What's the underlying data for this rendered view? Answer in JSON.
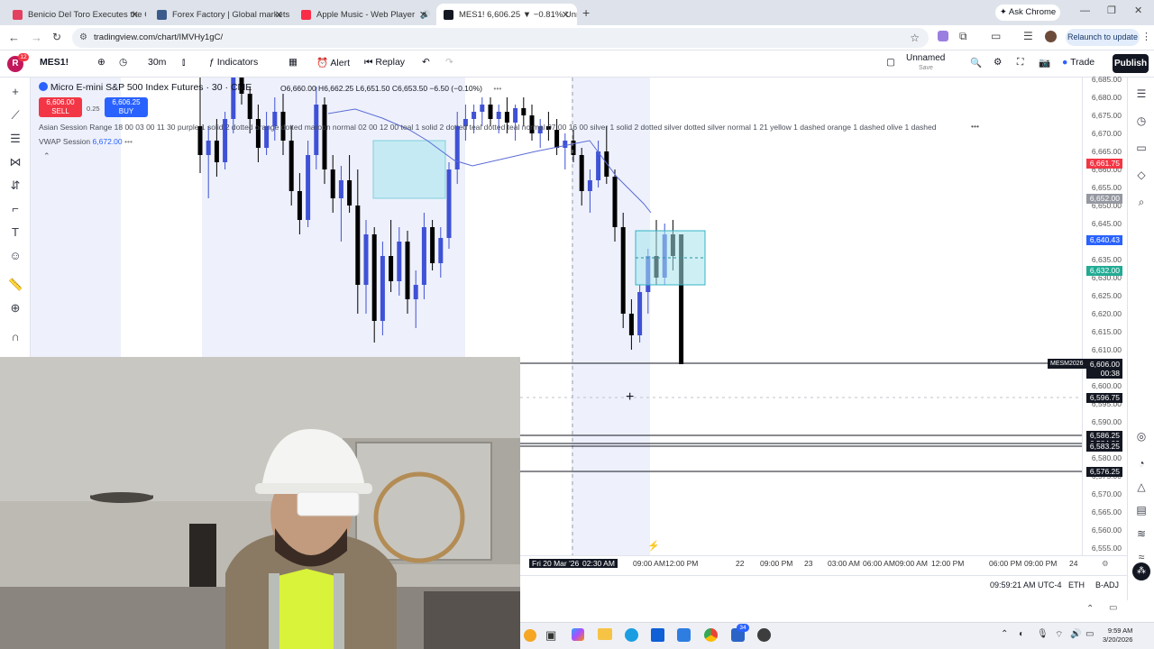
{
  "browser": {
    "tabs": [
      {
        "title": "Benicio Del Toro Executes the C",
        "color": "#e4405f"
      },
      {
        "title": "Forex Factory | Global markets",
        "color": "#3a5b8c"
      },
      {
        "title": "Apple Music - Web Player",
        "color": "#fa2d48"
      },
      {
        "title": "MES1! 6,606.25 ▼ −0.81% Unn",
        "color": "#131722"
      }
    ],
    "ask": "Ask Chrome",
    "url": "tradingview.com/chart/IMVHy1gC/",
    "relaunch": "Relaunch to update"
  },
  "toolbar": {
    "profile": "R",
    "profile_badge": "12",
    "symbol": "MES1!",
    "interval": "30m",
    "indicators": "Indicators",
    "alert": "Alert",
    "replay": "Replay",
    "layout_name": "Unnamed",
    "layout_sub": "Save",
    "trade": "Trade",
    "publish": "Publish"
  },
  "legend": {
    "title": "Micro E-mini S&P 500 Index Futures · 30 · CME",
    "ohlc": "O6,660.00 H6,662.25 L6,651.50 C6,653.50 −6.50 (−0.10%)",
    "sell_price": "6,606.00",
    "sell": "SELL",
    "spread": "0.25",
    "buy_price": "6,606.25",
    "buy": "BUY",
    "indicator1": "Asian Session Range 18 00 03 00 11 30 purple 1 solid 2 dotted orange dotted maroon normal 02 00 12 00 teal 1 solid 2 dotted teal dotted teal normal 07 00 16 00 silver 1 solid 2 dotted silver dotted silver normal 1 21 yellow 1 dashed orange 1 dashed olive 1 dashed",
    "indicator2_name": "VWAP Session",
    "indicator2_value": "6,672.00"
  },
  "chart_data": {
    "type": "candlestick",
    "symbol": "MES1!",
    "interval": "30m",
    "y_ticks": [
      6685,
      6680,
      6675,
      6670,
      6665,
      6660,
      6655,
      6650,
      6645,
      6640,
      6635,
      6630,
      6625,
      6620,
      6615,
      6610,
      6605,
      6600,
      6595,
      6590,
      6585,
      6580,
      6575,
      6570,
      6565,
      6560,
      6555
    ],
    "y_tick_labels": [
      "6,685.00",
      "6,680.00",
      "6,675.00",
      "6,670.00",
      "6,665.00",
      "6,660.00",
      "6,655.00",
      "6,650.00",
      "6,645.00",
      "6,640.00",
      "6,635.00",
      "6,630.00",
      "6,625.00",
      "6,620.00",
      "6,615.00",
      "6,610.00",
      "6,605.00",
      "6,600.00",
      "6,595.00",
      "6,590.00",
      "6,585.00",
      "6,580.00",
      "6,575.00",
      "6,570.00",
      "6,565.00",
      "6,560.00",
      "6,555.00"
    ],
    "ylim": [
      6553,
      6687
    ],
    "candles": [
      {
        "o": 6672,
        "h": 6690,
        "l": 6659,
        "c": 6664
      },
      {
        "o": 6664,
        "h": 6672,
        "l": 6652,
        "c": 6668
      },
      {
        "o": 6668,
        "h": 6674,
        "l": 6658,
        "c": 6662
      },
      {
        "o": 6662,
        "h": 6676,
        "l": 6660,
        "c": 6674
      },
      {
        "o": 6674,
        "h": 6690,
        "l": 6670,
        "c": 6686
      },
      {
        "o": 6686,
        "h": 6692,
        "l": 6678,
        "c": 6681
      },
      {
        "o": 6681,
        "h": 6683,
        "l": 6670,
        "c": 6674
      },
      {
        "o": 6674,
        "h": 6678,
        "l": 6662,
        "c": 6666
      },
      {
        "o": 6666,
        "h": 6676,
        "l": 6664,
        "c": 6672
      },
      {
        "o": 6672,
        "h": 6680,
        "l": 6668,
        "c": 6676
      },
      {
        "o": 6676,
        "h": 6681,
        "l": 6664,
        "c": 6668
      },
      {
        "o": 6668,
        "h": 6672,
        "l": 6650,
        "c": 6654
      },
      {
        "o": 6654,
        "h": 6659,
        "l": 6642,
        "c": 6646
      },
      {
        "o": 6646,
        "h": 6668,
        "l": 6644,
        "c": 6664
      },
      {
        "o": 6664,
        "h": 6683,
        "l": 6660,
        "c": 6678
      },
      {
        "o": 6678,
        "h": 6680,
        "l": 6656,
        "c": 6660
      },
      {
        "o": 6660,
        "h": 6664,
        "l": 6648,
        "c": 6652
      },
      {
        "o": 6652,
        "h": 6661,
        "l": 6640,
        "c": 6657
      },
      {
        "o": 6657,
        "h": 6664,
        "l": 6648,
        "c": 6650
      },
      {
        "o": 6650,
        "h": 6660,
        "l": 6620,
        "c": 6628
      },
      {
        "o": 6628,
        "h": 6646,
        "l": 6620,
        "c": 6642
      },
      {
        "o": 6642,
        "h": 6644,
        "l": 6612,
        "c": 6618
      },
      {
        "o": 6618,
        "h": 6640,
        "l": 6614,
        "c": 6636
      },
      {
        "o": 6636,
        "h": 6646,
        "l": 6626,
        "c": 6629
      },
      {
        "o": 6629,
        "h": 6644,
        "l": 6625,
        "c": 6640
      },
      {
        "o": 6640,
        "h": 6643,
        "l": 6620,
        "c": 6624
      },
      {
        "o": 6624,
        "h": 6632,
        "l": 6616,
        "c": 6628
      },
      {
        "o": 6628,
        "h": 6648,
        "l": 6624,
        "c": 6644
      },
      {
        "o": 6644,
        "h": 6646,
        "l": 6632,
        "c": 6634
      },
      {
        "o": 6634,
        "h": 6644,
        "l": 6630,
        "c": 6641
      },
      {
        "o": 6641,
        "h": 6662,
        "l": 6638,
        "c": 6660
      },
      {
        "o": 6660,
        "h": 6676,
        "l": 6656,
        "c": 6672
      },
      {
        "o": 6672,
        "h": 6678,
        "l": 6668,
        "c": 6674
      },
      {
        "o": 6674,
        "h": 6678,
        "l": 6670,
        "c": 6676
      },
      {
        "o": 6676,
        "h": 6680,
        "l": 6672,
        "c": 6678
      },
      {
        "o": 6678,
        "h": 6680,
        "l": 6672,
        "c": 6674
      },
      {
        "o": 6674,
        "h": 6678,
        "l": 6670,
        "c": 6676
      },
      {
        "o": 6676,
        "h": 6680,
        "l": 6670,
        "c": 6673
      },
      {
        "o": 6673,
        "h": 6678,
        "l": 6668,
        "c": 6677
      },
      {
        "o": 6677,
        "h": 6680,
        "l": 6672,
        "c": 6675
      },
      {
        "o": 6675,
        "h": 6678,
        "l": 6668,
        "c": 6670
      },
      {
        "o": 6670,
        "h": 6674,
        "l": 6666,
        "c": 6672
      },
      {
        "o": 6672,
        "h": 6676,
        "l": 6668,
        "c": 6671
      },
      {
        "o": 6671,
        "h": 6674,
        "l": 6664,
        "c": 6666
      },
      {
        "o": 6666,
        "h": 6670,
        "l": 6660,
        "c": 6668
      },
      {
        "o": 6668,
        "h": 6671,
        "l": 6662,
        "c": 6664
      },
      {
        "o": 6664,
        "h": 6666,
        "l": 6650,
        "c": 6654
      },
      {
        "o": 6654,
        "h": 6660,
        "l": 6648,
        "c": 6657
      },
      {
        "o": 6657,
        "h": 6668,
        "l": 6655,
        "c": 6665
      },
      {
        "o": 6665,
        "h": 6672,
        "l": 6656,
        "c": 6658
      },
      {
        "o": 6658,
        "h": 6660,
        "l": 6640,
        "c": 6644
      },
      {
        "o": 6644,
        "h": 6648,
        "l": 6616,
        "c": 6620
      },
      {
        "o": 6620,
        "h": 6624,
        "l": 6610,
        "c": 6614
      },
      {
        "o": 6614,
        "h": 6628,
        "l": 6612,
        "c": 6626
      },
      {
        "o": 6626,
        "h": 6638,
        "l": 6620,
        "c": 6636
      },
      {
        "o": 6636,
        "h": 6646,
        "l": 6628,
        "c": 6630
      },
      {
        "o": 6630,
        "h": 6645,
        "l": 6628,
        "c": 6642
      },
      {
        "o": 6642,
        "h": 6646,
        "l": 6632,
        "c": 6636
      },
      {
        "o": 6642,
        "h": 6642,
        "l": 6606,
        "c": 6606
      }
    ],
    "horizontal_levels": [
      {
        "price": 6606.25,
        "label": "6,606.25",
        "style": "solid"
      },
      {
        "price": 6596.75,
        "label": "6,596.75",
        "style": "dashed"
      },
      {
        "price": 6586.25,
        "label": "6,586.25",
        "style": "solid"
      },
      {
        "price": 6584.0,
        "label": "6,584.00",
        "style": "solid"
      },
      {
        "price": 6583.25,
        "label": "6,583.25",
        "style": "solid"
      },
      {
        "price": 6576.25,
        "label": "6,576.25",
        "style": "solid"
      }
    ],
    "price_tags": [
      {
        "price": 6661.75,
        "label": "6,661.75",
        "color": "#f23645"
      },
      {
        "price": 6652.0,
        "label": "6,652.00",
        "color": "#9598a1"
      },
      {
        "price": 6640.43,
        "label": "6,640.43",
        "color": "#2962ff"
      },
      {
        "price": 6632.0,
        "label": "6,632.00",
        "color": "#22ab94"
      },
      {
        "price": 6606.25,
        "label": "6,606.25",
        "color": "#131722",
        "extra": "00:38",
        "name": "MESM2026"
      },
      {
        "price": 6606.0,
        "label": "6,606.00",
        "color": "#131722"
      },
      {
        "price": 6596.75,
        "label": "6,596.75",
        "color": "#131722"
      },
      {
        "price": 6586.25,
        "label": "6,586.25",
        "color": "#131722"
      },
      {
        "price": 6584.0,
        "label": "6,584.00",
        "color": "#131722"
      },
      {
        "price": 6583.25,
        "label": "6,583.25",
        "color": "#131722"
      },
      {
        "price": 6576.25,
        "label": "6,576.25",
        "color": "#131722"
      }
    ],
    "boxes": [
      {
        "from": 6668,
        "to": 6652,
        "color": "#a6e3ec"
      },
      {
        "from": 6643,
        "to": 6628,
        "color": "#a6e3ec"
      }
    ],
    "x_labels": [
      "Fri 20 Mar '26",
      "02:30 AM",
      "09:00 AM",
      "12:00 PM",
      "22",
      "09:00 PM",
      "23",
      "03:00 AM",
      "06:00 AM",
      "09:00 AM",
      "12:00 PM",
      "06:00 PM",
      "09:00 PM",
      "24"
    ]
  },
  "status": {
    "clock": "09:59:21 AM UTC-4",
    "session": "ETH",
    "adj": "B-ADJ"
  },
  "taskbar": {
    "time": "9:59 AM",
    "date": "3/20/2026",
    "badge": "34"
  }
}
